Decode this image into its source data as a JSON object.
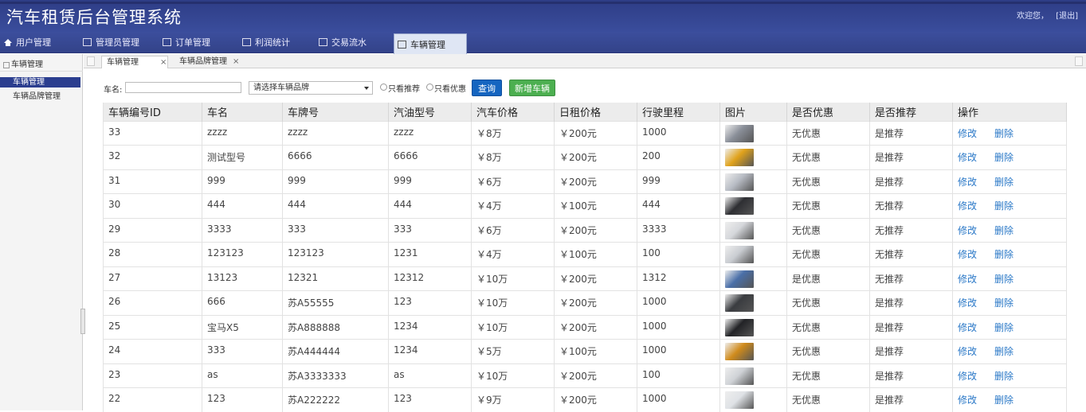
{
  "app": {
    "title": "汽车租赁后台管理系统",
    "welcome": "欢迎您，",
    "logout": "[退出]"
  },
  "nav": {
    "items": [
      {
        "label": "用户管理",
        "icon": "home-icon"
      },
      {
        "label": "管理员管理",
        "icon": "window-icon"
      },
      {
        "label": "订单管理",
        "icon": "window-icon"
      },
      {
        "label": "利润统计",
        "icon": "window-icon"
      },
      {
        "label": "交易流水",
        "icon": "window-icon"
      },
      {
        "label": "车辆管理",
        "icon": "window-icon",
        "active": true
      }
    ]
  },
  "sidebar": {
    "heading": "车辆管理",
    "items": [
      {
        "label": "车辆管理",
        "active": true
      },
      {
        "label": "车辆品牌管理"
      }
    ]
  },
  "tabs": [
    {
      "label": "车辆管理",
      "close": "×",
      "active": true
    },
    {
      "label": "车辆品牌管理",
      "close": "×"
    }
  ],
  "toolbar": {
    "name_label": "车名:",
    "name_value": "",
    "brand_placeholder": "请选择车辆品牌",
    "only_recommended": "只看推荐",
    "only_discount": "只看优惠",
    "query_label": "查询",
    "add_label": "新增车辆",
    "query_color": "#1565c0",
    "add_color": "#4caf50"
  },
  "table": {
    "headers": [
      "车辆编号ID",
      "车名",
      "车牌号",
      "汽油型号",
      "汽车价格",
      "日租价格",
      "行驶里程",
      "图片",
      "是否优惠",
      "是否推荐",
      "操作"
    ],
    "edit_label": "修改",
    "delete_label": "删除",
    "rows": [
      {
        "id": "33",
        "name": "zzzz",
        "plate": "zzzz",
        "fuel": "zzzz",
        "price": "￥8万",
        "daily": "￥200元",
        "mileage": "1000",
        "img": "car-photo",
        "discount": "无优惠",
        "recommend": "是推荐"
      },
      {
        "id": "32",
        "name": "测试型号",
        "plate": "6666",
        "fuel": "6666",
        "price": "￥8万",
        "daily": "￥200元",
        "mileage": "200",
        "img": "car-photo",
        "discount": "无优惠",
        "recommend": "是推荐"
      },
      {
        "id": "31",
        "name": "999",
        "plate": "999",
        "fuel": "999",
        "price": "￥6万",
        "daily": "￥200元",
        "mileage": "999",
        "img": "car-photo",
        "discount": "无优惠",
        "recommend": "是推荐"
      },
      {
        "id": "30",
        "name": "444",
        "plate": "444",
        "fuel": "444",
        "price": "￥4万",
        "daily": "￥100元",
        "mileage": "444",
        "img": "car-photo",
        "discount": "无优惠",
        "recommend": "无推荐"
      },
      {
        "id": "29",
        "name": "3333",
        "plate": "333",
        "fuel": "333",
        "price": "￥6万",
        "daily": "￥200元",
        "mileage": "3333",
        "img": "car-photo",
        "discount": "无优惠",
        "recommend": "无推荐"
      },
      {
        "id": "28",
        "name": "123123",
        "plate": "123123",
        "fuel": "1231",
        "price": "￥4万",
        "daily": "￥100元",
        "mileage": "100",
        "img": "car-photo",
        "discount": "无优惠",
        "recommend": "无推荐"
      },
      {
        "id": "27",
        "name": "13123",
        "plate": "12321",
        "fuel": "12312",
        "price": "￥10万",
        "daily": "￥200元",
        "mileage": "1312",
        "img": "car-photo",
        "discount": "是优惠",
        "recommend": "无推荐"
      },
      {
        "id": "26",
        "name": "666",
        "plate": "苏A55555",
        "fuel": "123",
        "price": "￥10万",
        "daily": "￥200元",
        "mileage": "1000",
        "img": "car-photo",
        "discount": "无优惠",
        "recommend": "是推荐"
      },
      {
        "id": "25",
        "name": "宝马X5",
        "plate": "苏A888888",
        "fuel": "1234",
        "price": "￥10万",
        "daily": "￥200元",
        "mileage": "1000",
        "img": "car-photo",
        "discount": "无优惠",
        "recommend": "是推荐"
      },
      {
        "id": "24",
        "name": "333",
        "plate": "苏A444444",
        "fuel": "1234",
        "price": "￥5万",
        "daily": "￥100元",
        "mileage": "1000",
        "img": "car-photo",
        "discount": "无优惠",
        "recommend": "是推荐"
      },
      {
        "id": "23",
        "name": "as",
        "plate": "苏A3333333",
        "fuel": "as",
        "price": "￥10万",
        "daily": "￥200元",
        "mileage": "100",
        "img": "car-photo",
        "discount": "无优惠",
        "recommend": "是推荐"
      },
      {
        "id": "22",
        "name": "123",
        "plate": "苏A222222",
        "fuel": "123",
        "price": "￥9万",
        "daily": "￥200元",
        "mileage": "1000",
        "img": "car-photo",
        "discount": "无优惠",
        "recommend": "是推荐"
      }
    ]
  }
}
